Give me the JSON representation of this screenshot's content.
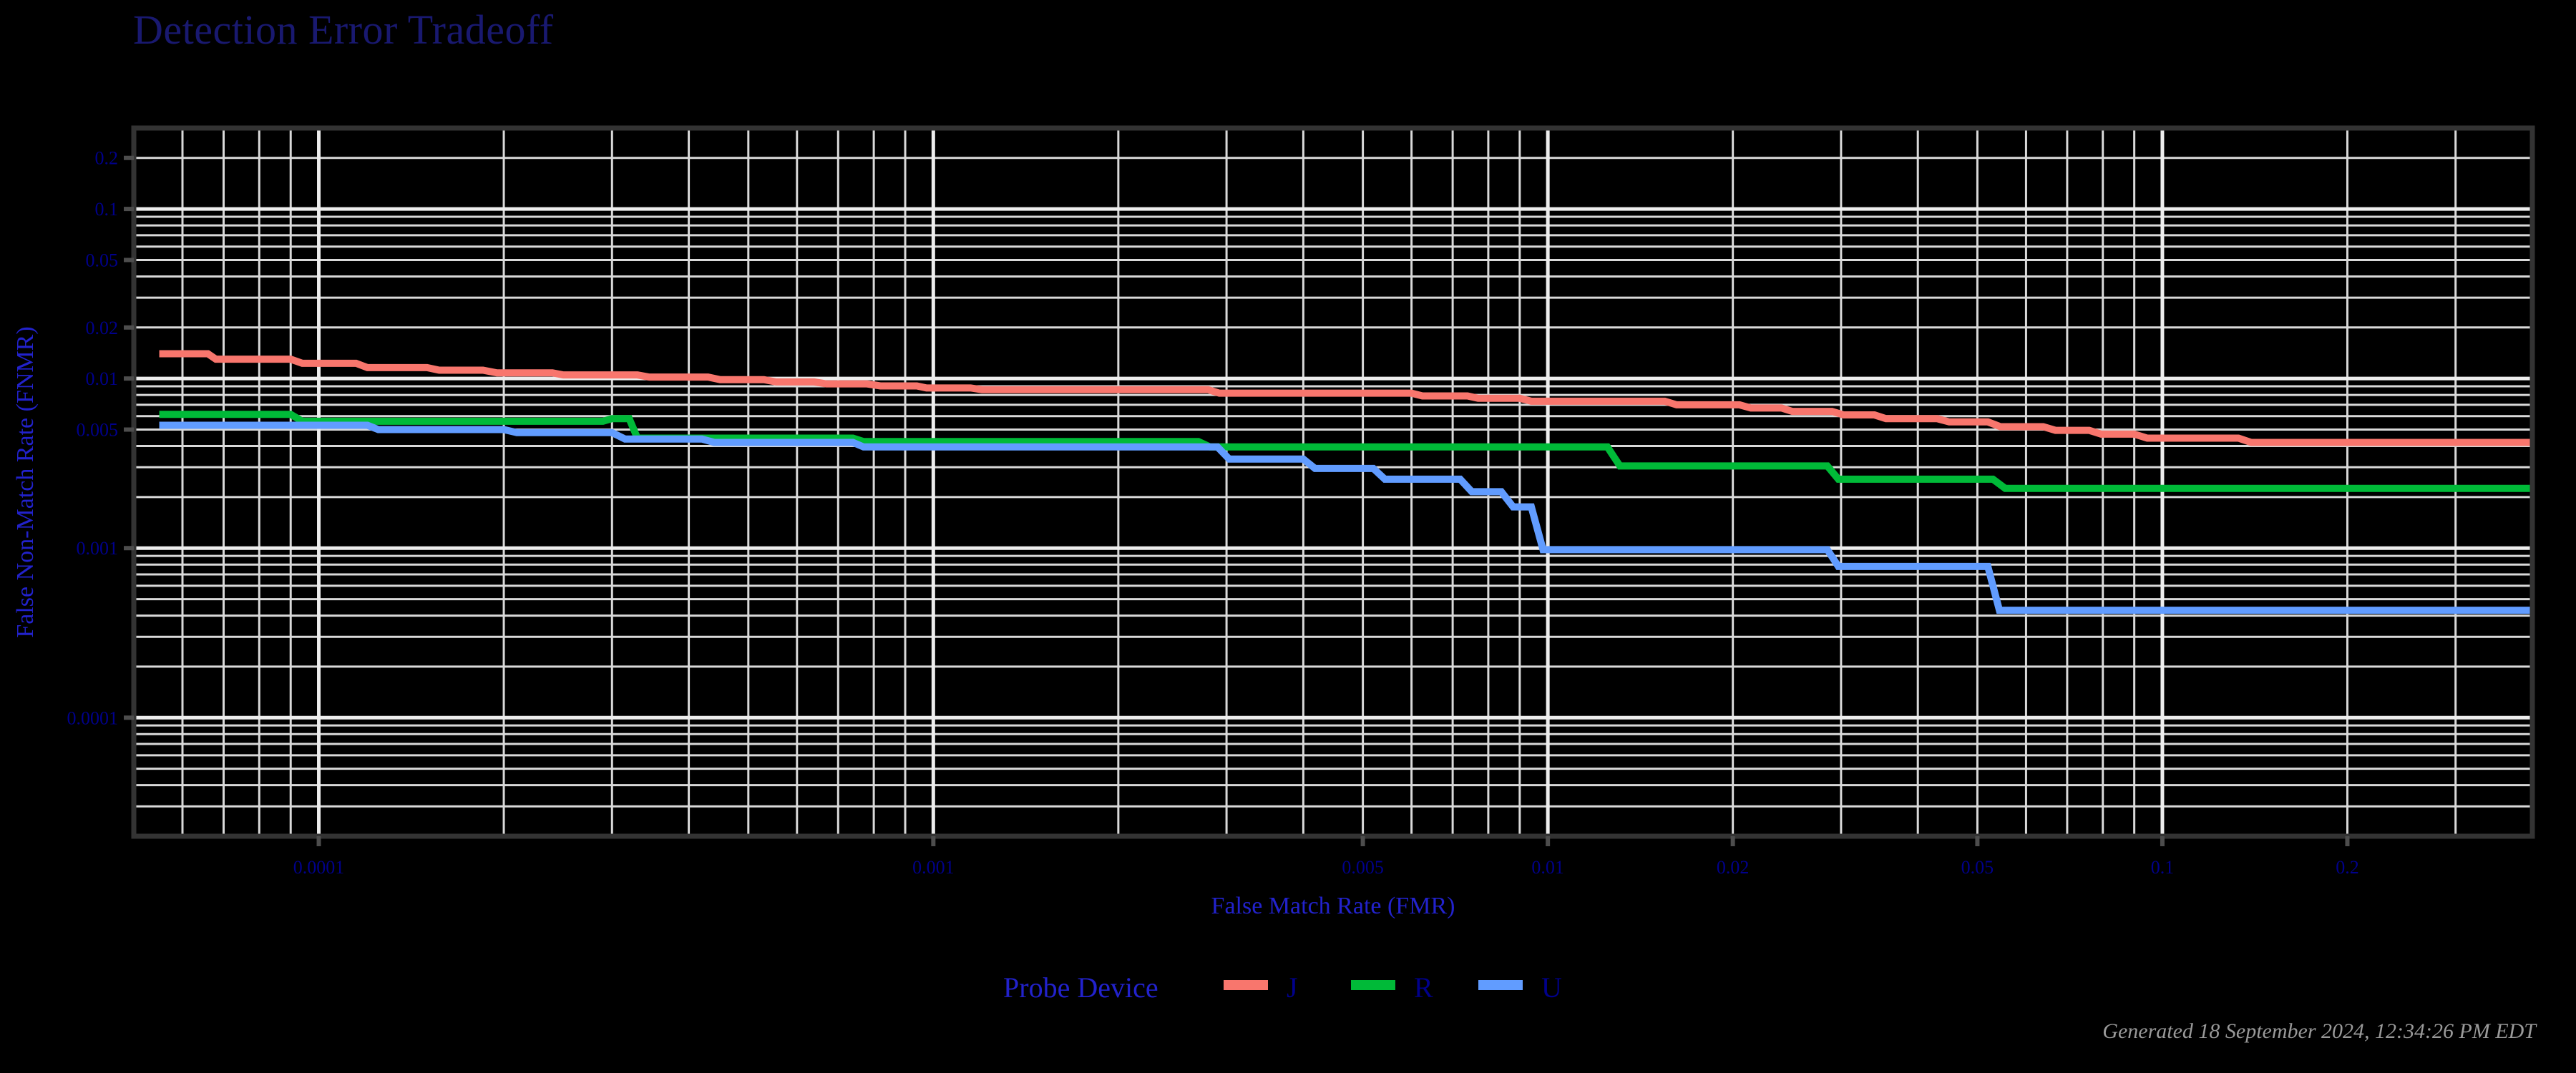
{
  "title": "Detection Error Tradeoff",
  "footer": "Generated 18 September 2024, 12:34:26 PM EDT",
  "legend": {
    "title": "Probe Device",
    "items": [
      {
        "label": "J",
        "color": "#F8766D"
      },
      {
        "label": "R",
        "color": "#00BA38"
      },
      {
        "label": "U",
        "color": "#619CFF"
      }
    ]
  },
  "chart_data": {
    "type": "line",
    "title": "Detection Error Tradeoff",
    "xlabel": "False Match Rate (FMR)",
    "ylabel": "False Non-Match Rate (FNMR)",
    "xscale": "log",
    "yscale": "log",
    "xlim": [
      5e-05,
      0.4
    ],
    "ylim": [
      2e-05,
      0.3
    ],
    "grid": true,
    "legend_position": "bottom",
    "legend_title": "Probe Device",
    "xticks": [
      0.0001,
      0.001,
      0.005,
      0.01,
      0.02,
      0.05,
      0.1,
      0.2
    ],
    "xticklabels": [
      "0.0001",
      "0.001",
      "0.005",
      "0.01",
      "0.02",
      "0.05",
      "0.1",
      "0.2"
    ],
    "yticks": [
      0.0001,
      0.001,
      0.005,
      0.01,
      0.02,
      0.05,
      0.1,
      0.2
    ],
    "yticklabels": [
      "0.0001",
      "0.001",
      "0.005",
      "0.01",
      "0.02",
      "0.05",
      "0.1",
      "0.2"
    ],
    "series": [
      {
        "name": "J",
        "color": "#F8766D",
        "points": [
          [
            5.5e-05,
            0.014
          ],
          [
            6.6e-05,
            0.014
          ],
          [
            6.8e-05,
            0.013
          ],
          [
            9e-05,
            0.013
          ],
          [
            9.4e-05,
            0.0123
          ],
          [
            0.000115,
            0.0123
          ],
          [
            0.00012,
            0.0116
          ],
          [
            0.00015,
            0.0116
          ],
          [
            0.000157,
            0.0112
          ],
          [
            0.000185,
            0.0112
          ],
          [
            0.000195,
            0.0108
          ],
          [
            0.00024,
            0.0108
          ],
          [
            0.00025,
            0.0105
          ],
          [
            0.00033,
            0.0105
          ],
          [
            0.000345,
            0.0102
          ],
          [
            0.00043,
            0.0102
          ],
          [
            0.00045,
            0.00985
          ],
          [
            0.00053,
            0.00985
          ],
          [
            0.000555,
            0.00955
          ],
          [
            0.00064,
            0.00955
          ],
          [
            0.00067,
            0.0093
          ],
          [
            0.00078,
            0.0093
          ],
          [
            0.00082,
            0.00905
          ],
          [
            0.00094,
            0.00905
          ],
          [
            0.000975,
            0.0088
          ],
          [
            0.00115,
            0.0088
          ],
          [
            0.0012,
            0.0086
          ],
          [
            0.0028,
            0.0086
          ],
          [
            0.00292,
            0.0082
          ],
          [
            0.006,
            0.0082
          ],
          [
            0.00625,
            0.0079
          ],
          [
            0.0074,
            0.0079
          ],
          [
            0.0077,
            0.00765
          ],
          [
            0.009,
            0.00765
          ],
          [
            0.0094,
            0.00735
          ],
          [
            0.0155,
            0.00735
          ],
          [
            0.0162,
            0.007
          ],
          [
            0.0205,
            0.007
          ],
          [
            0.0214,
            0.0067
          ],
          [
            0.024,
            0.0067
          ],
          [
            0.025,
            0.0064
          ],
          [
            0.029,
            0.0064
          ],
          [
            0.0303,
            0.0061
          ],
          [
            0.034,
            0.0061
          ],
          [
            0.0355,
            0.0058
          ],
          [
            0.043,
            0.0058
          ],
          [
            0.045,
            0.00555
          ],
          [
            0.052,
            0.00555
          ],
          [
            0.0545,
            0.0052
          ],
          [
            0.064,
            0.0052
          ],
          [
            0.067,
            0.00495
          ],
          [
            0.076,
            0.00495
          ],
          [
            0.0795,
            0.0047
          ],
          [
            0.09,
            0.0047
          ],
          [
            0.0945,
            0.00445
          ],
          [
            0.133,
            0.00445
          ],
          [
            0.1395,
            0.0042
          ],
          [
            0.4,
            0.0042
          ]
        ]
      },
      {
        "name": "R",
        "color": "#00BA38",
        "points": [
          [
            5.5e-05,
            0.00615
          ],
          [
            9e-05,
            0.00615
          ],
          [
            9.4e-05,
            0.0056
          ],
          [
            0.00029,
            0.0056
          ],
          [
            0.0003,
            0.0058
          ],
          [
            0.00032,
            0.0058
          ],
          [
            0.00033,
            0.00445
          ],
          [
            0.00074,
            0.00445
          ],
          [
            0.00077,
            0.00425
          ],
          [
            0.0027,
            0.00425
          ],
          [
            0.00282,
            0.00395
          ],
          [
            0.0125,
            0.00395
          ],
          [
            0.0131,
            0.00305
          ],
          [
            0.0285,
            0.00305
          ],
          [
            0.0297,
            0.00255
          ],
          [
            0.053,
            0.00255
          ],
          [
            0.0555,
            0.00225
          ],
          [
            0.4,
            0.00225
          ]
        ]
      },
      {
        "name": "U",
        "color": "#619CFF",
        "points": [
          [
            5.5e-05,
            0.0053
          ],
          [
            0.00012,
            0.0053
          ],
          [
            0.000125,
            0.005
          ],
          [
            0.0002,
            0.005
          ],
          [
            0.00021,
            0.0048
          ],
          [
            0.0003,
            0.0048
          ],
          [
            0.000315,
            0.0044
          ],
          [
            0.00042,
            0.0044
          ],
          [
            0.00044,
            0.0042
          ],
          [
            0.00074,
            0.0042
          ],
          [
            0.00077,
            0.00395
          ],
          [
            0.0029,
            0.00395
          ],
          [
            0.00303,
            0.00335
          ],
          [
            0.004,
            0.00335
          ],
          [
            0.00418,
            0.00295
          ],
          [
            0.0052,
            0.00295
          ],
          [
            0.00543,
            0.00255
          ],
          [
            0.0072,
            0.00255
          ],
          [
            0.00752,
            0.00215
          ],
          [
            0.0084,
            0.00215
          ],
          [
            0.00878,
            0.00175
          ],
          [
            0.0094,
            0.00175
          ],
          [
            0.00982,
            0.00098
          ],
          [
            0.0285,
            0.00098
          ],
          [
            0.0297,
            0.00078
          ],
          [
            0.052,
            0.00078
          ],
          [
            0.0543,
            0.00043
          ],
          [
            0.4,
            0.00043
          ]
        ]
      }
    ]
  }
}
